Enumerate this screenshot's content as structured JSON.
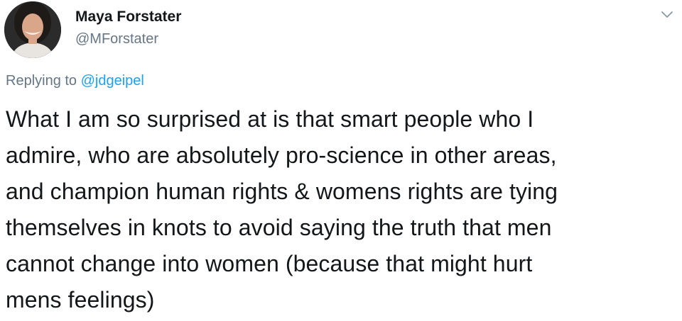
{
  "author": {
    "name": "Maya Forstater",
    "handle": "@MForstater",
    "avatar_icon": "profile-photo"
  },
  "menu": {
    "icon": "chevron-down-icon"
  },
  "reply": {
    "prefix": "Replying to",
    "mention": "@jdgeipel"
  },
  "tweet": {
    "lines": [
      "What I am so surprised at is that smart people who I",
      "admire, who are absolutely pro-science in other areas,",
      "and champion human rights & womens rights are tying",
      "themselves in knots to avoid saying the truth that men",
      "cannot change into women (because that might hurt",
      "mens feelings)"
    ]
  },
  "colors": {
    "text": "#14171a",
    "secondary": "#657786",
    "link": "#1da1f2"
  }
}
